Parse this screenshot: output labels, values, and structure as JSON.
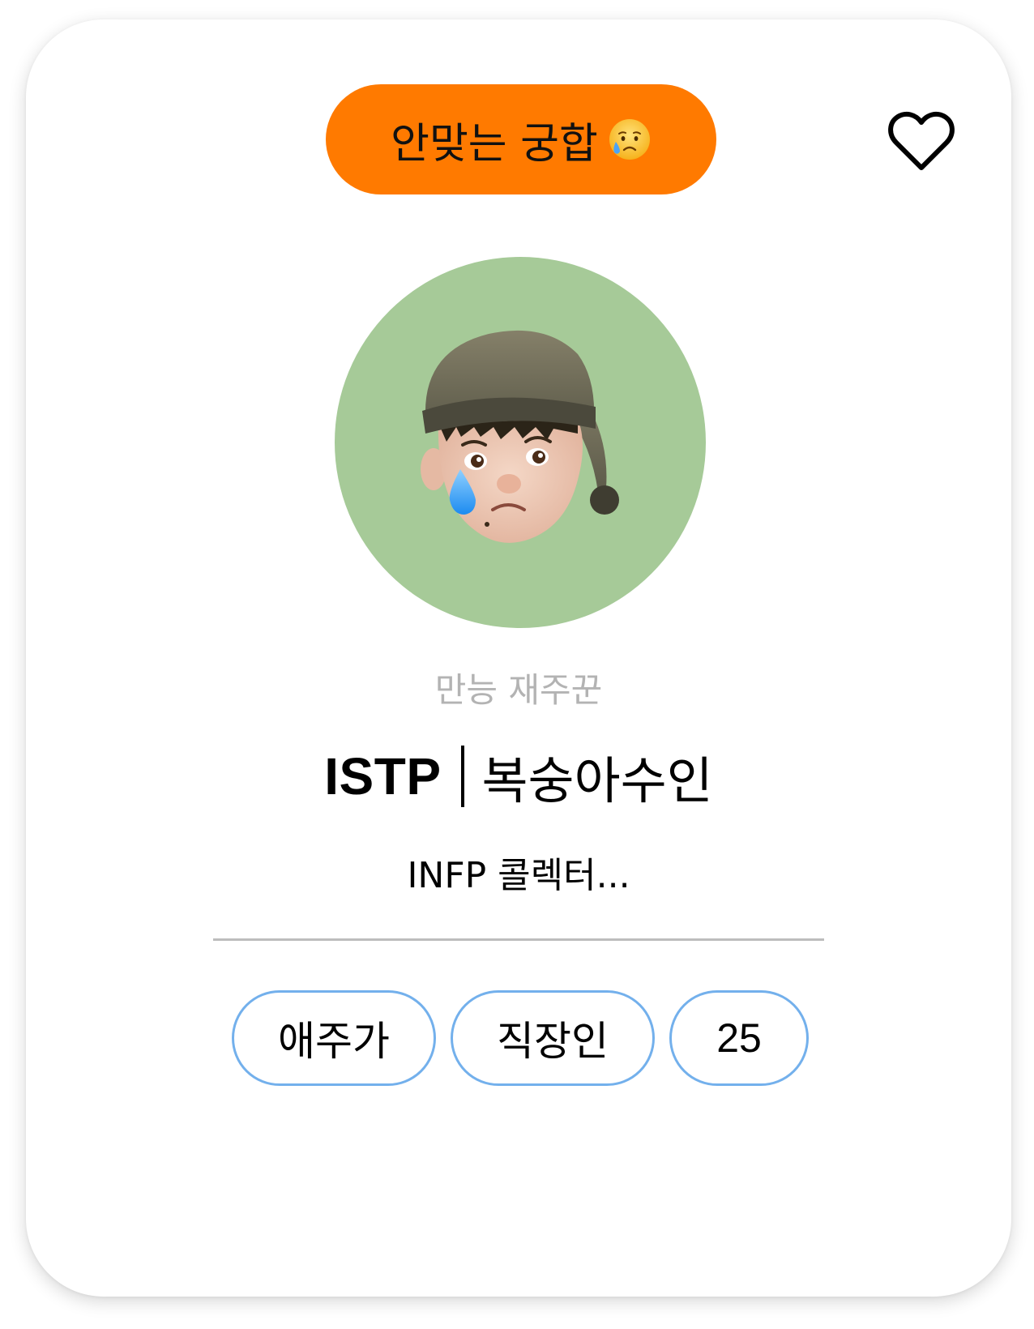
{
  "header": {
    "match_label": "안맞는 궁합",
    "match_emoji": "sad-but-relieved-face-icon",
    "badge_color": "#FF7A00"
  },
  "favorite": {
    "icon": "heart-outline-icon",
    "selected": false
  },
  "profile": {
    "avatar_icon": "memoji-sad-boy-nightcap",
    "avatar_bg": "#A6CA98",
    "subtitle": "만능 재주꾼",
    "mbti": "ISTP",
    "nickname": "복숭아수인",
    "bio": "INFP 콜렉터..."
  },
  "tags": [
    {
      "label": "애주가"
    },
    {
      "label": "직장인"
    },
    {
      "label": "25"
    }
  ],
  "colors": {
    "tag_border": "#73B0EC",
    "divider": "#BDBDBD",
    "subtitle_text": "#B3B3B3"
  }
}
